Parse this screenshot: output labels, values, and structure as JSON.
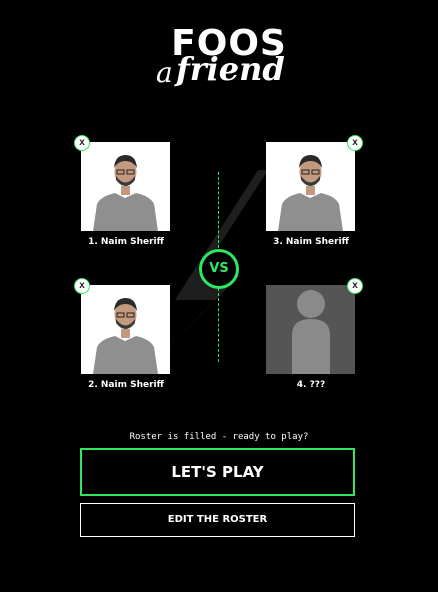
{
  "logo": {
    "line1": "FOOS",
    "a": "a",
    "friend": "friend"
  },
  "vs_label": "VS",
  "players": [
    {
      "name": "1. Naim Sheriff",
      "photo": "person-photo",
      "removable": true
    },
    {
      "name": "2. Naim Sheriff",
      "photo": "person-photo",
      "removable": true
    },
    {
      "name": "3. Naim Sheriff",
      "photo": "person-photo",
      "removable": true
    },
    {
      "name": "4. ???",
      "photo": "placeholder-avatar",
      "removable": true
    }
  ],
  "close_label": "x",
  "status": "Roster is filled - ready to play?",
  "buttons": {
    "play": "LET'S PLAY",
    "edit": "EDIT THE ROSTER"
  },
  "colors": {
    "accent": "#2ee860",
    "background": "#000000",
    "placeholder": "#555555"
  }
}
